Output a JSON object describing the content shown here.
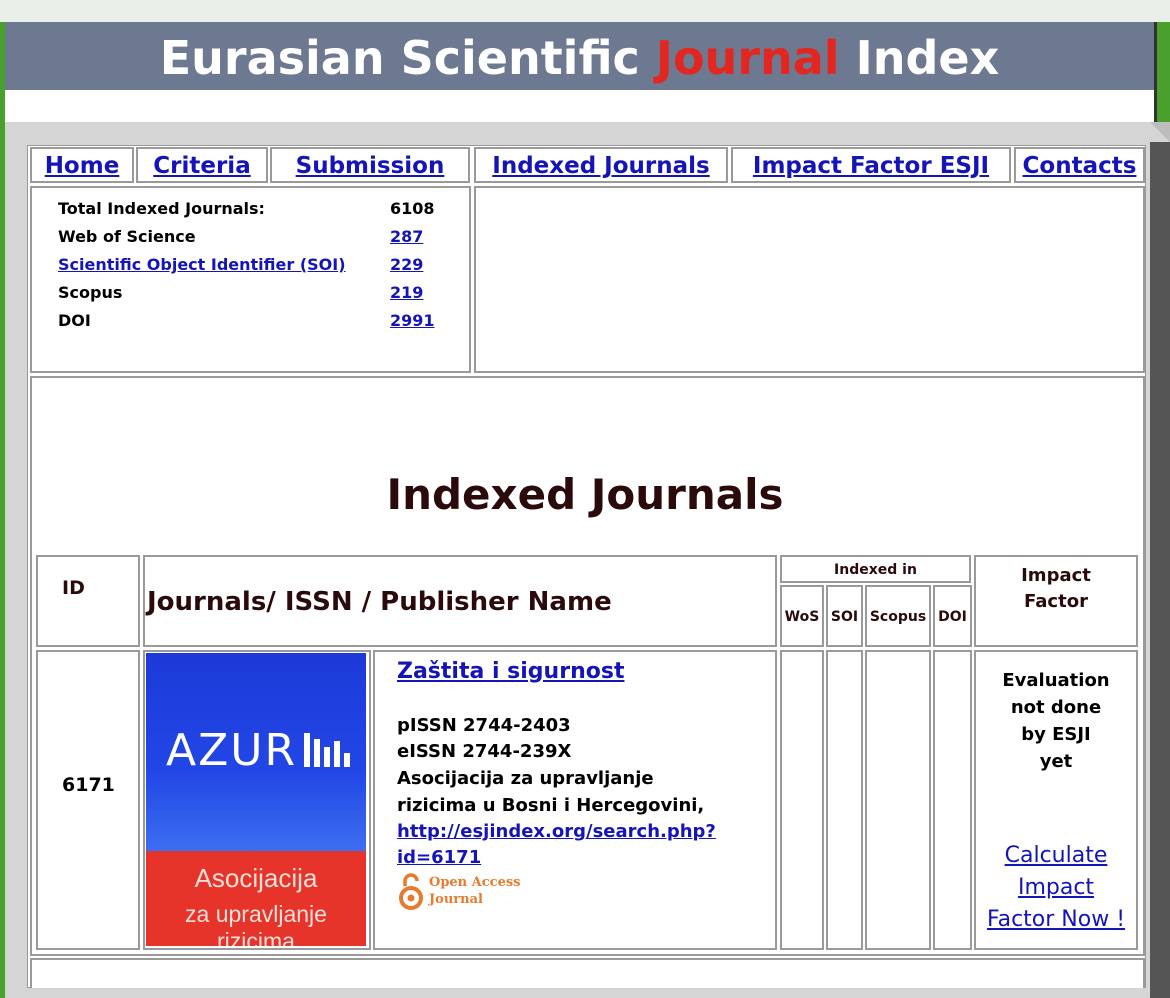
{
  "header": {
    "title_part1": "Eurasian Scientific ",
    "title_part2": "Journal",
    "title_part3": " Index",
    "accent_color": "#e3261f",
    "bg_color": "#6d7891"
  },
  "nav": [
    {
      "label": "Home"
    },
    {
      "label": "Criteria"
    },
    {
      "label": "Submission"
    },
    {
      "label": "Indexed Journals"
    },
    {
      "label": "Impact Factor ESJI"
    },
    {
      "label": "Contacts"
    }
  ],
  "stats": {
    "total_label": "Total Indexed Journals:",
    "total_value": "6108",
    "wos_label": "Web of Science",
    "wos_value": "287",
    "soi_label": "Scientific Object Identifier (SOI)",
    "soi_value": "229",
    "scopus_label": "Scopus",
    "scopus_value": "219",
    "doi_label": "DOI",
    "doi_value": "2991"
  },
  "page_title": "Indexed Journals",
  "table": {
    "col_id": "ID",
    "col_journal": "Journals/ ISSN / Publisher Name",
    "col_indexed_in": "Indexed in",
    "col_wos": "WoS",
    "col_soi": "SOI",
    "col_scopus": "Scopus",
    "col_doi": "DOI",
    "col_impact": "Impact Factor"
  },
  "journal": {
    "id": "6171",
    "title": "Zaštita i sigurnost",
    "pissn": "pISSN 2744-2403",
    "eissn": "eISSN 2744-239X",
    "publisher_line1": "Asocijacija za upravljanje",
    "publisher_line2": "rizicima u Bosni i Hercegovini,",
    "url_line1": "http://esjindex.org/search.php?",
    "url_line2": "id=6171",
    "open_access_line1": "Open Access",
    "open_access_line2": "Journal",
    "logo_text": "AZUR",
    "logo_sub1": "Asocijacija",
    "logo_sub2": "za upravljanje rizicima",
    "impact_line1": "Evaluation",
    "impact_line2": "not done",
    "impact_line3": "by ESJI",
    "impact_line4": "yet",
    "calc_line1": "Calculate",
    "calc_line2": "Impact",
    "calc_line3": "Factor Now !"
  }
}
